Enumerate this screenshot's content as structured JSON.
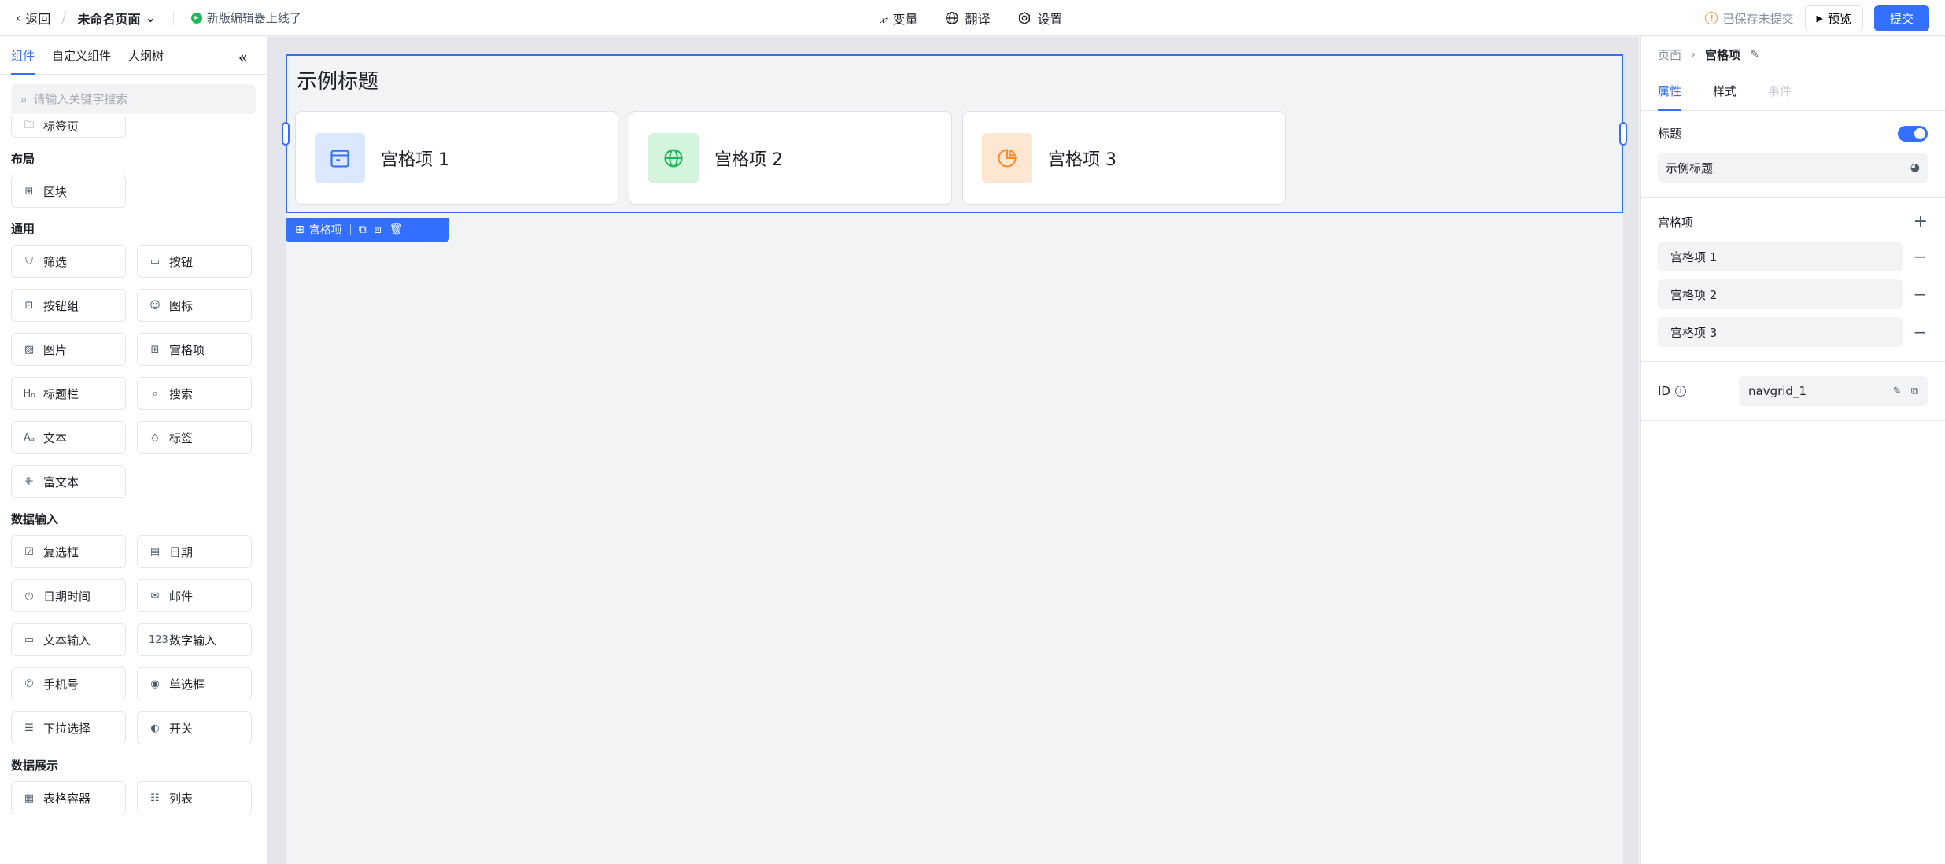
{
  "topbar": {
    "back_label": "返回",
    "page_name": "未命名页面",
    "new_editor_notice": "新版编辑器上线了",
    "tools": [
      {
        "label": "变量",
        "icon": "variable-icon"
      },
      {
        "label": "翻译",
        "icon": "globe-icon"
      },
      {
        "label": "设置",
        "icon": "gear-icon"
      }
    ],
    "save_status": "已保存未提交",
    "preview_label": "预览",
    "submit_label": "提交"
  },
  "left_panel": {
    "tabs": [
      "组件",
      "自定义组件",
      "大纲树"
    ],
    "active_tab": 0,
    "search_placeholder": "请输入关键字搜索",
    "partial_item": "标签页",
    "sections": [
      {
        "title": "布局",
        "items": [
          {
            "label": "区块",
            "icon": "⊞"
          }
        ]
      },
      {
        "title": "通用",
        "items": [
          {
            "label": "筛选",
            "icon": "⛉"
          },
          {
            "label": "按钮",
            "icon": "▭"
          },
          {
            "label": "按钮组",
            "icon": "⊡"
          },
          {
            "label": "图标",
            "icon": "☺"
          },
          {
            "label": "图片",
            "icon": "▨"
          },
          {
            "label": "宫格项",
            "icon": "⊞"
          },
          {
            "label": "标题栏",
            "icon": "Hₙ"
          },
          {
            "label": "搜索",
            "icon": "⌕"
          },
          {
            "label": "文本",
            "icon": "Aₐ"
          },
          {
            "label": "标签",
            "icon": "◇"
          },
          {
            "label": "富文本",
            "icon": "⁜"
          }
        ]
      },
      {
        "title": "数据输入",
        "items": [
          {
            "label": "复选框",
            "icon": "☑"
          },
          {
            "label": "日期",
            "icon": "▤"
          },
          {
            "label": "日期时间",
            "icon": "◷"
          },
          {
            "label": "邮件",
            "icon": "✉"
          },
          {
            "label": "文本输入",
            "icon": "▭"
          },
          {
            "label": "数字输入",
            "icon": "123"
          },
          {
            "label": "手机号",
            "icon": "✆"
          },
          {
            "label": "单选框",
            "icon": "◉"
          },
          {
            "label": "下拉选择",
            "icon": "☰"
          },
          {
            "label": "开关",
            "icon": "◐"
          }
        ]
      },
      {
        "title": "数据展示",
        "items": [
          {
            "label": "表格容器",
            "icon": "▦"
          },
          {
            "label": "列表",
            "icon": "☷"
          }
        ]
      }
    ]
  },
  "canvas": {
    "nav_grid": {
      "title": "示例标题",
      "items": [
        {
          "label": "宫格项 1",
          "icon": "calendar-icon",
          "bg": "#dbe8ff",
          "fg": "#3370ff"
        },
        {
          "label": "宫格项 2",
          "icon": "globe-icon",
          "bg": "#d4f4dc",
          "fg": "#23b55a"
        },
        {
          "label": "宫格项 3",
          "icon": "pie-chart-icon",
          "bg": "#fde7d2",
          "fg": "#ff8a2a"
        }
      ]
    },
    "selection_toolbar": {
      "label": "宫格项"
    }
  },
  "right_panel": {
    "breadcrumb": [
      "页面",
      "宫格项"
    ],
    "tabs": [
      "属性",
      "样式",
      "事件"
    ],
    "active_tab": 0,
    "title_label": "标题",
    "title_enabled": true,
    "title_value": "示例标题",
    "items_label": "宫格项",
    "items": [
      "宫格项 1",
      "宫格项 2",
      "宫格项 3"
    ],
    "id_label": "ID",
    "id_value": "navgrid_1"
  },
  "colors": {
    "accent": "#3370ff",
    "success": "#23b55a",
    "warning": "#ff9a2e"
  }
}
